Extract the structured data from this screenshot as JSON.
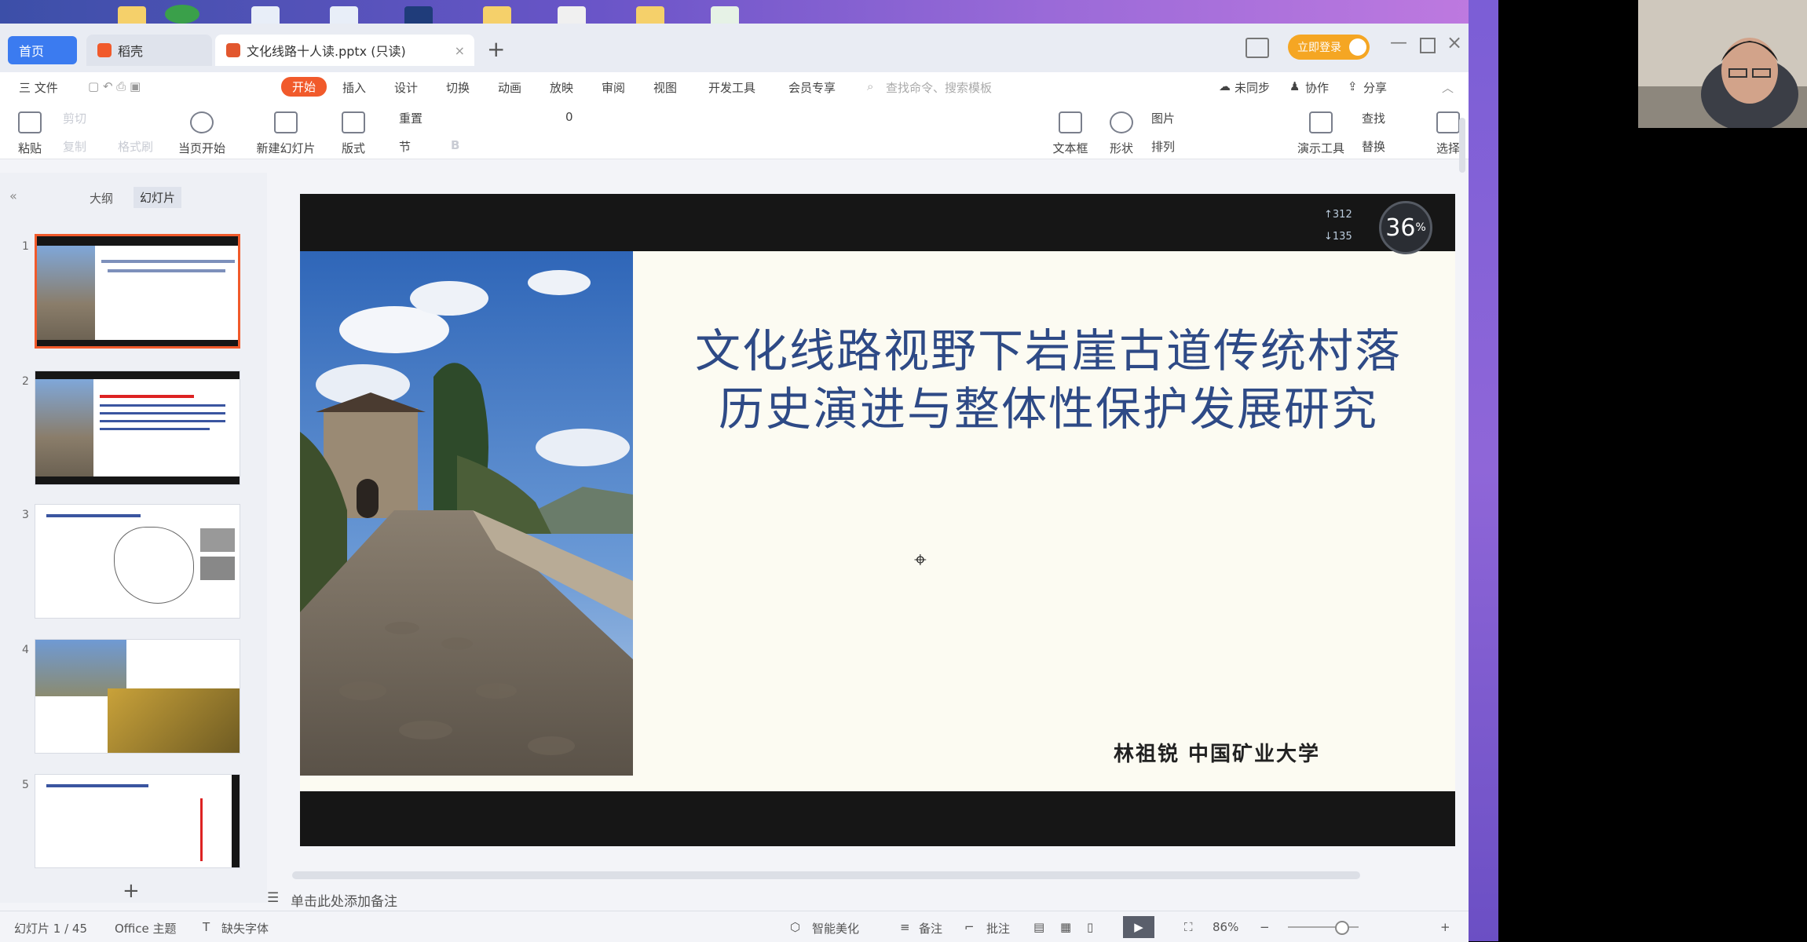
{
  "tabs": {
    "home": "首页",
    "daoke": "稻壳",
    "doc": "文化线路十人读.pptx (只读)",
    "new_tab": "+"
  },
  "header": {
    "login": "立即登录"
  },
  "menu": {
    "file": "三 文件",
    "items": [
      "开始",
      "插入",
      "设计",
      "切换",
      "动画",
      "放映",
      "审阅",
      "视图",
      "开发工具",
      "会员专享"
    ],
    "search_placeholder": "查找命令、搜索模板",
    "sync": "未同步",
    "collab": "协作",
    "share": "分享"
  },
  "ribbon": {
    "paste": "粘贴",
    "cut": "剪切",
    "format_painter": "格式刷",
    "copy": "复制",
    "from_current": "当页开始",
    "new_slide": "新建幻灯片",
    "layout": "版式",
    "section": "节",
    "reset": "重置",
    "font_size": "0",
    "bold": "B",
    "text_box": "文本框",
    "shapes": "形状",
    "picture": "图片",
    "arrange": "排列",
    "presentation_tools": "演示工具",
    "find": "查找",
    "replace": "替换",
    "select": "选择"
  },
  "left_panel": {
    "tab_outline": "大纲",
    "tab_slides": "幻灯片",
    "thumb_numbers": [
      "1",
      "2",
      "3",
      "4",
      "5"
    ],
    "add": "+"
  },
  "slide": {
    "title_line1": "文化线路视野下岩崖古道传统村落",
    "title_line2": "历史演进与整体性保护发展研究",
    "author": "林祖锐  中国矿业大学"
  },
  "net_widget": {
    "up": "312",
    "down": "135",
    "percent": "36"
  },
  "notes": {
    "placeholder": "单击此处添加备注"
  },
  "status": {
    "slide_count": "幻灯片 1 / 45",
    "theme": "Office 主题",
    "missing_font": "缺失字体",
    "beautify": "智能美化",
    "notes": "备注",
    "comments": "批注",
    "zoom": "86%"
  },
  "colors": {
    "accent": "#f15a2b",
    "title_blue": "#2e4a86",
    "home_tab": "#3b7bf0"
  }
}
